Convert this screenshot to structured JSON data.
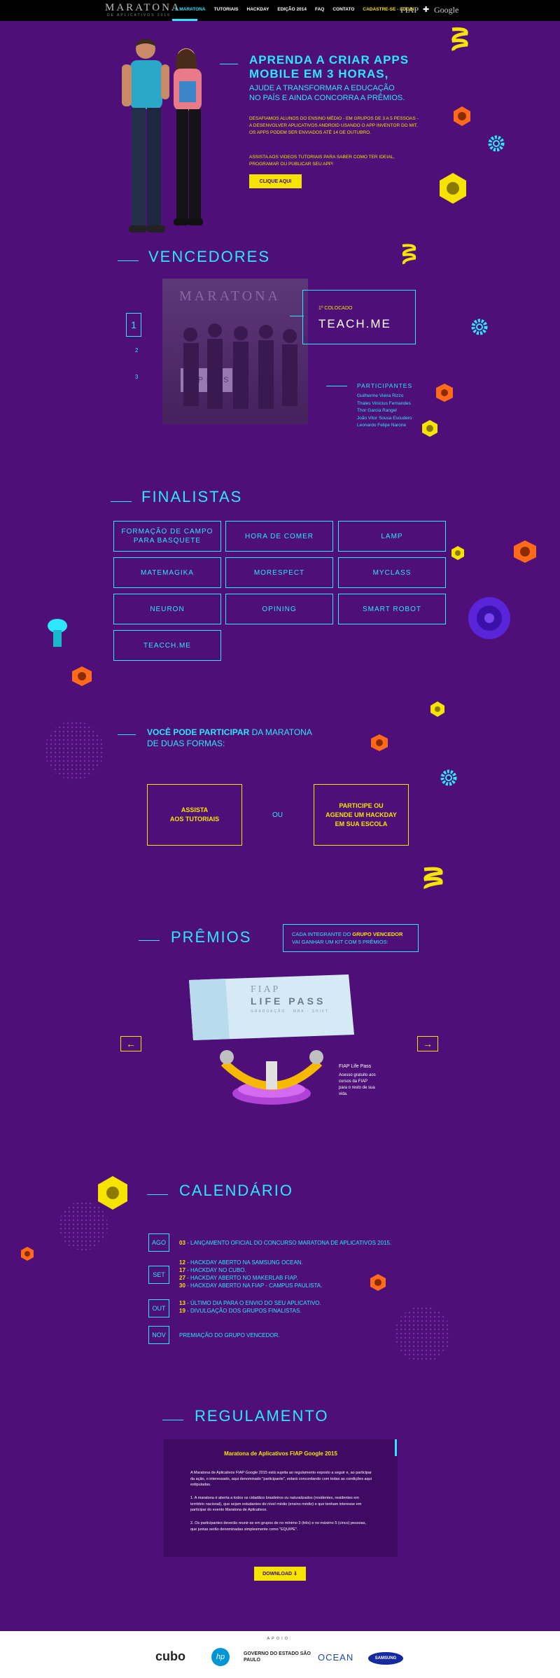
{
  "nav": {
    "logo": "MARATONA",
    "logo_sub": "DE APLICATIVOS 2015",
    "items": [
      "A MARATONA",
      "TUTORIAIS",
      "HACKDAY",
      "EDIÇÃO 2014",
      "FAQ",
      "CONTATO",
      "CADASTRE-SE - LOGIN"
    ],
    "partner_fiap": "FIAP",
    "partner_plus": "✚",
    "partner_google": "Google"
  },
  "hero": {
    "title_line1": "APRENDA A CRIAR APPS",
    "title_line2": "MOBILE EM 3 HORAS,",
    "subtitle_line1": "AJUDE A TRANSFORMAR A EDUCAÇÃO",
    "subtitle_line2": "NO PAÍS E AINDA CONCORRA A PRÊMIOS.",
    "body1_line1": "DESAFIAMOS ALUNOS DO ENSINO MÉDIO - EM GRUPOS DE 3 A 5 PESSOAS -",
    "body1_line2": "A DESENVOLVER APLICATIVOS ANDROID USANDO O APP INVENTOR DO MIT.",
    "body1_line3": "OS APPS PODEM SER ENVIADOS ATÉ 14 DE OUTUBRO.",
    "body2_line1": "ASSISTA AOS VIDEOS TUTORIAIS PARA SABER COMO TER IDEIAL,",
    "body2_line2": "PROGRAMAR OU PUBLICAR SEU APP!",
    "cta": "CLIQUE AQUI"
  },
  "winners": {
    "title": "VENCEDORES",
    "pages": [
      "1",
      "2",
      "3"
    ],
    "place": "1º COLOCADO",
    "name": "TEACH.ME",
    "photo_caption": "MARATONA",
    "photo_caption2": "FIAP PASS",
    "participants_label": "PARTICIPANTES",
    "participants": [
      "Guilherme Vieira Rizzo",
      "Thales Vinícius Fernandes",
      "Thor Garcia Rangel",
      "João Vitor Sousa Escudero",
      "Leonardo Felipe Narone"
    ]
  },
  "finalists": {
    "title": "FINALISTAS",
    "items": [
      "FORMAÇÃO DE CAMPO\nPARA BASQUETE",
      "HORA DE COMER",
      "LAMP",
      "MATEMAGIKA",
      "MORESPECT",
      "MYCLASS",
      "NEURON",
      "OPINING",
      "SMART ROBOT",
      "TEACCH.ME"
    ]
  },
  "participate": {
    "title_bold": "VOCÊ PODE PARTICIPAR",
    "title_rest": " DA MARATONA",
    "title_line2": "DE DUAS FORMAS:",
    "option1": "ASSISTA\nAOS TUTORIAIS",
    "or": "OU",
    "option2": "PARTICIPE OU\nAGENDE UM HACKDAY\nEM SUA ESCOLA"
  },
  "prizes": {
    "title": "PRÊMIOS",
    "note_pre": "CADA INTEGRANTE DO ",
    "note_bold": "GRUPO VENCEDOR",
    "note_line2": "VAI GANHAR UM KIT COM 5 PRÊMIOS:",
    "card_fiap": "FIAP",
    "card_lifepass": "LIFE PASS",
    "card_sub": "GRADUAÇÃO · MBA · SHIFT",
    "prize_name": "FIAP Life Pass",
    "prize_desc": "Acesso gratuito aos cursos da FIAP para o resto de sua vida.",
    "prev": "←",
    "next": "→"
  },
  "calendar": {
    "title": "CALENDÁRIO",
    "months": [
      "AGO",
      "SET",
      "OUT",
      "NOV"
    ],
    "events": [
      [
        "03",
        " - LANÇAMENTO OFICIAL DO CONCURSO MARATONA DE APLICATIVOS 2015."
      ],
      [
        "12",
        " - HACKDAY ABERTO NA SAMSUNG OCEAN."
      ],
      [
        "17",
        " - HACKDAY NO CUBO."
      ],
      [
        "27",
        " - HACKDAY ABERTO NO MAKERLAB FIAP."
      ],
      [
        "30",
        " - HACKDAY ABERTO NA FIAP - CAMPUS PAULISTA."
      ],
      [
        "13",
        " - ÚLTIMO DIA PARA O ENVIO DO SEU APLICATIVO."
      ],
      [
        "19",
        " - DIVULGAÇÃO DOS GRUPOS FINALISTAS."
      ],
      [
        "",
        "PREMIAÇÃO DO GRUPO VENCEDOR."
      ]
    ]
  },
  "rules": {
    "title": "REGULAMENTO",
    "doc_title": "Maratona de Aplicativos FIAP Google 2015",
    "p1": "A Maratona de Aplicativos FIAP Google 2015 está sujeita ao regulamento exposto a seguir e, ao participar da ação, o interessado, aqui denominado \"participante\", estará concordando com todas as condições aqui estipuladas.",
    "p2": "1. A maratona é aberta a todos os cidadãos brasileiros ou naturalizados (residentes, residentes em território nacional), que sejam estudantes do nível médio (ensino médio) e que tenham interesse em participar do evento Maratona de Aplicativos.",
    "p3": "2. Os participantes deverão reunir-se em grupos de no mínimo 3 (três) e no máximo 5 (cinco) pessoas, que juntas serão denominadas simplesmente como \"EQUIPE\".",
    "download": "DOWNLOAD ⇩"
  },
  "footer": {
    "label": "APOIO:",
    "sponsors": [
      "cubo",
      "hp",
      "GOVERNO DO ESTADO SÃO PAULO",
      "OCEAN",
      "SAMSUNG"
    ]
  }
}
